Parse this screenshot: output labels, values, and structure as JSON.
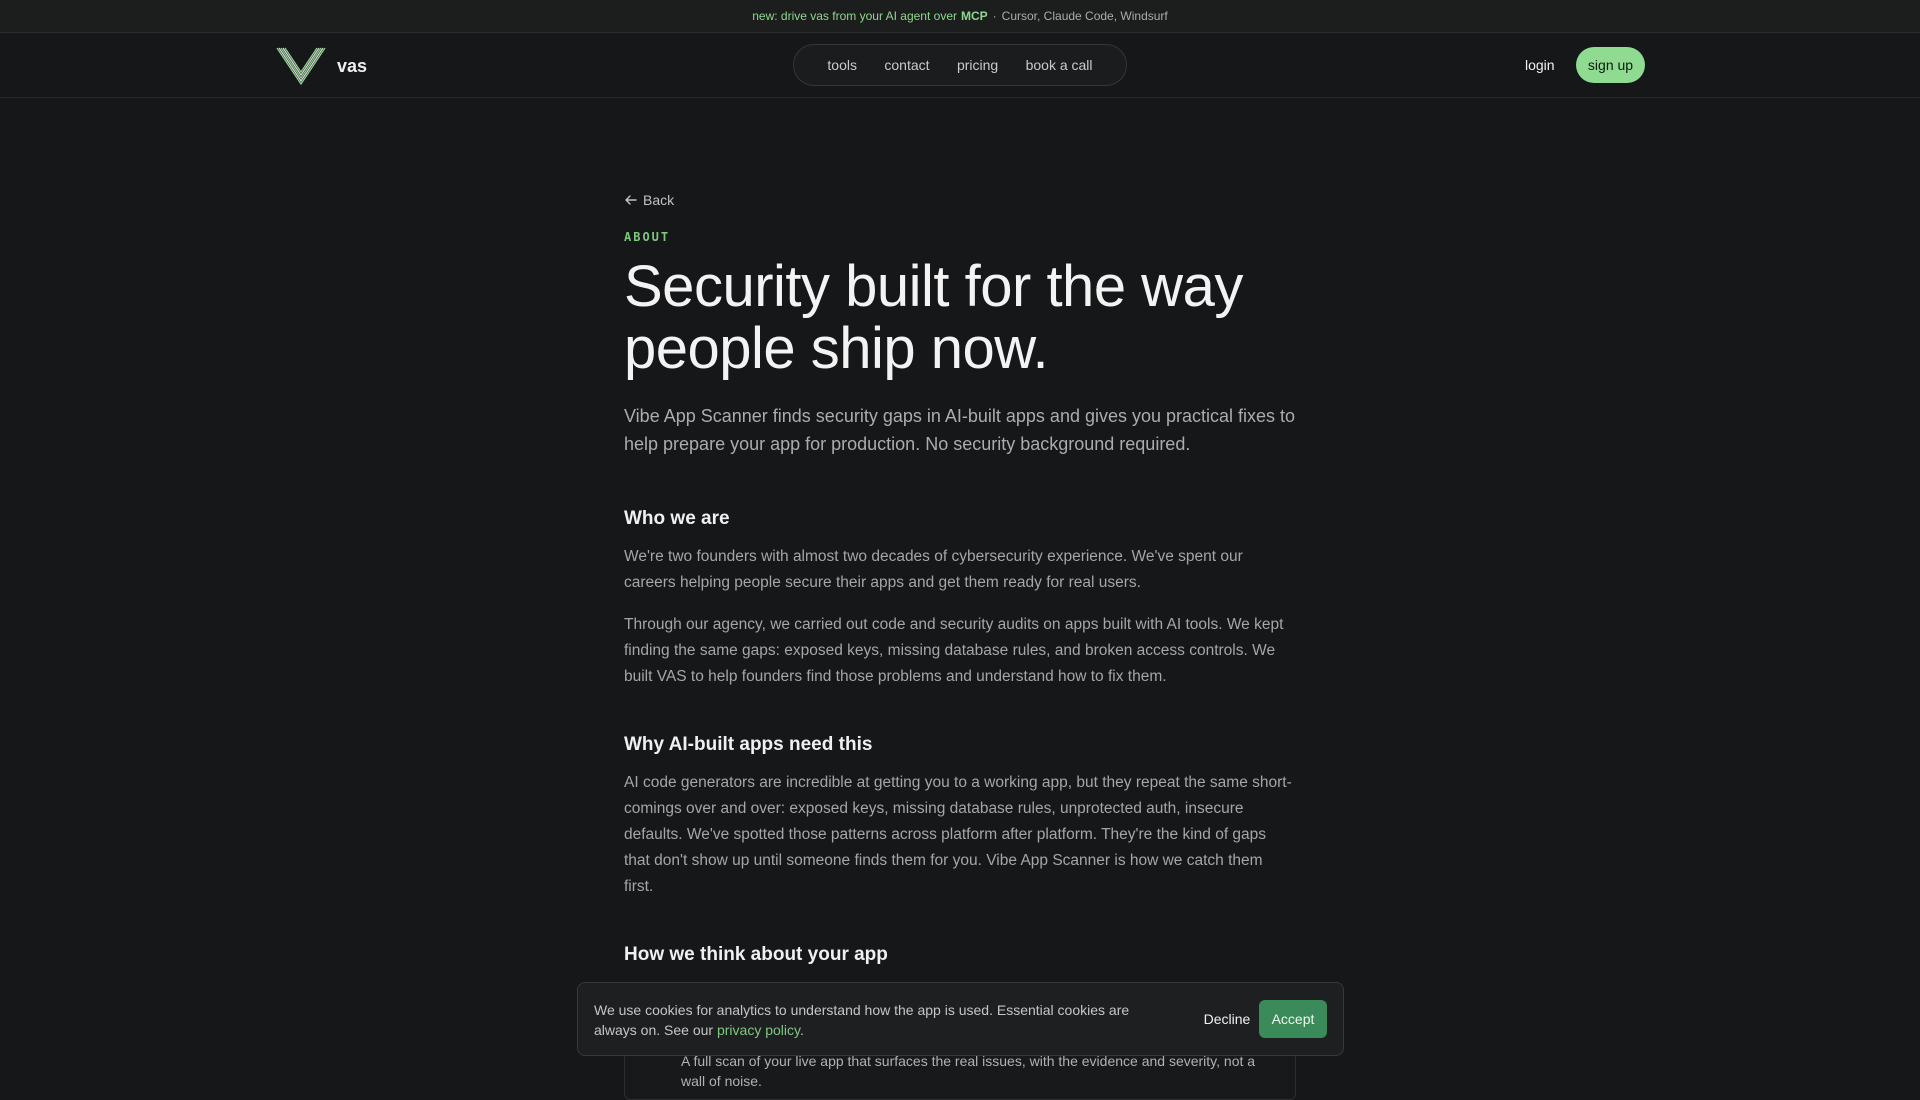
{
  "announcement": {
    "highlight": "new: drive vas from your AI agent over",
    "mcp": "MCP",
    "separator": "·",
    "tools": "Cursor, Claude Code, Windsurf"
  },
  "header": {
    "brand_name": "vas",
    "logo_icon": "v-logo-icon",
    "nav": [
      {
        "label": "tools"
      },
      {
        "label": "contact"
      },
      {
        "label": "pricing"
      },
      {
        "label": "book a call"
      }
    ],
    "login_label": "login",
    "signup_label": "sign up"
  },
  "main": {
    "back_label": "Back",
    "back_icon": "arrow-left-icon",
    "eyebrow": "ABOUT",
    "title_line1": "Security built for the way",
    "title_line2": "people ship now.",
    "lede": "Vibe App Scanner finds security gaps in AI-built apps and gives you practical fixes to help prepare your app for production. No security background required.",
    "sections": [
      {
        "heading": "Who we are",
        "paragraphs": [
          "We're two founders with almost two decades of cybersecurity experience. We've spent our careers helping people secure their apps and get them ready for real users.",
          "Through our agency, we carried out code and security audits on apps built with AI tools. We kept finding the same gaps: exposed keys, missing database rules, and broken access controls. We built VAS to help founders find those problems and understand how to fix them."
        ]
      },
      {
        "heading": "Why AI-built apps need this",
        "paragraphs": [
          "AI code generators are incredible at getting you to a working app, but they repeat the same short-comings over and over: exposed keys, missing database rules, unprotected auth, insecure defaults. We've spotted those patterns across platform after platform. They're the kind of gaps that don't show up until someone finds them for you. Vibe App Scanner is how we catch them first."
        ]
      },
      {
        "heading": "How we think about your app",
        "card_text": "A full scan of your live app that surfaces the real issues, with the evidence and severity, not a wall of noise."
      }
    ]
  },
  "cookie": {
    "message": "We use cookies for analytics to understand how the app is used. Essential cookies are always on. See our",
    "link": "privacy policy",
    "period": ".",
    "decline_label": "Decline",
    "accept_label": "Accept"
  },
  "colors": {
    "accent": "#8edb91",
    "accept_button": "#3a8a5a",
    "background": "#161719"
  }
}
